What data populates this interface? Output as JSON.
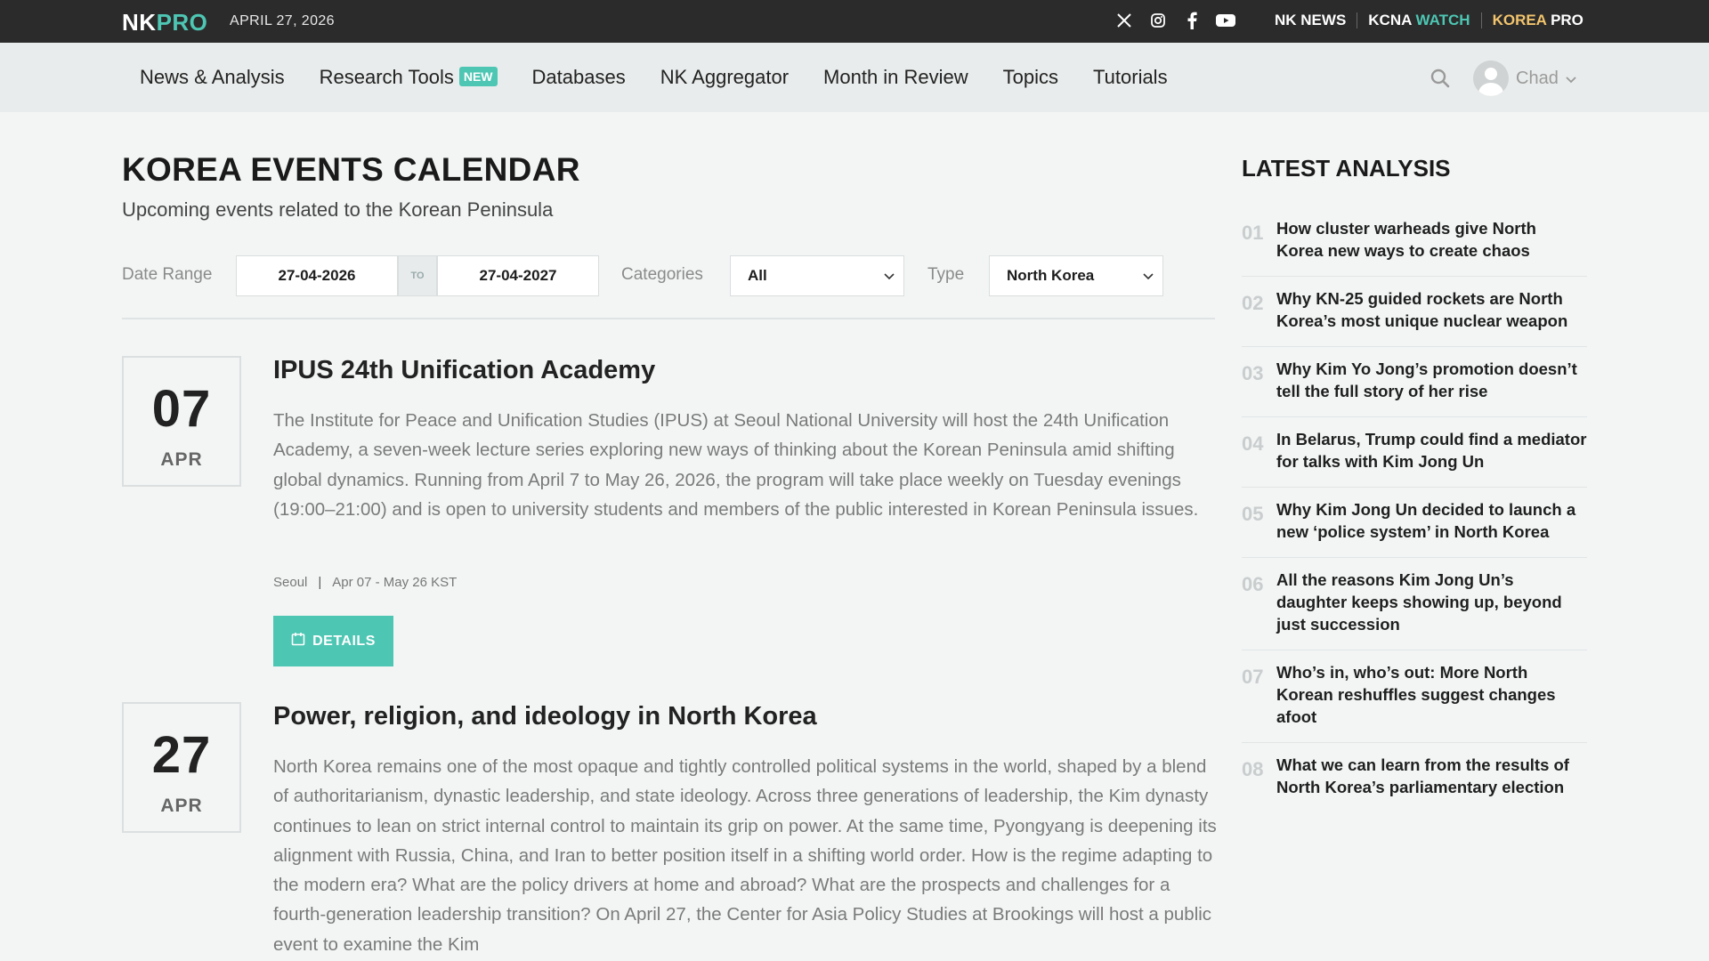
{
  "topbar": {
    "logo_nk": "NK",
    "logo_pro": "PRO",
    "date": "APRIL 27, 2026",
    "social_icons": [
      "x-icon",
      "instagram-icon",
      "facebook-icon",
      "youtube-icon"
    ],
    "sites": {
      "nknews": "NK NEWS",
      "kcna_1": "KCNA",
      "kcna_2": "WATCH",
      "kp_1": "KOREA",
      "kp_2": "PRO"
    }
  },
  "nav": {
    "items": [
      "News & Analysis",
      "Research Tools",
      "Databases",
      "NK Aggregator",
      "Month in Review",
      "Topics",
      "Tutorials"
    ],
    "new_badge": "NEW",
    "user_name": "Chad"
  },
  "page": {
    "title": "KOREA EVENTS CALENDAR",
    "subtitle": "Upcoming events related to the Korean Peninsula"
  },
  "filters": {
    "date_range_label": "Date Range",
    "date_from": "27-04-2026",
    "to_label": "TO",
    "date_to": "27-04-2027",
    "categories_label": "Categories",
    "categories_value": "All",
    "type_label": "Type",
    "type_value": "North Korea"
  },
  "events": [
    {
      "day": "07",
      "month": "APR",
      "title": "IPUS 24th Unification Academy",
      "description": "The Institute for Peace and Unification Studies (IPUS) at Seoul National University will host the 24th Unification Academy, a seven-week lecture series exploring new ways of thinking about the Korean Peninsula amid shifting global dynamics. Running from April 7 to May 26, 2026, the program will take place weekly on Tuesday evenings (19:00–21:00) and is open to university students and members of the public interested in Korean Peninsula issues.",
      "location": "Seoul",
      "when": "Apr 07 - May 26 KST",
      "button": "DETAILS"
    },
    {
      "day": "27",
      "month": "APR",
      "title": "Power, religion, and ideology in North Korea",
      "description": "North Korea remains one of the most opaque and tightly controlled political systems in the world, shaped by a blend of authoritarianism, dynastic leadership, and state ideology. Across three generations of leadership, the Kim dynasty continues to lean on strict internal control to maintain its grip on power. At the same time, Pyongyang is deepening its alignment with Russia, China, and Iran to better position itself in a shifting world order. How is the regime adapting to the modern era? What are the policy drivers at home and abroad? What are the prospects and challenges for a fourth-generation leadership transition? On April 27, the Center for Asia Policy Studies at Brookings will host a public event to examine the Kim"
    }
  ],
  "sidebar": {
    "title": "LATEST ANALYSIS",
    "items": [
      {
        "num": "01",
        "text": "How cluster warheads give North Korea new ways to create chaos"
      },
      {
        "num": "02",
        "text": "Why KN-25 guided rockets are North Korea’s most unique nuclear weapon"
      },
      {
        "num": "03",
        "text": "Why Kim Yo Jong’s promotion doesn’t tell the full story of her rise"
      },
      {
        "num": "04",
        "text": "In Belarus, Trump could find a mediator for talks with Kim Jong Un"
      },
      {
        "num": "05",
        "text": "Why Kim Jong Un decided to launch a new ‘police system’ in North Korea"
      },
      {
        "num": "06",
        "text": "All the reasons Kim Jong Un’s daughter keeps showing up, beyond just succession"
      },
      {
        "num": "07",
        "text": "Who’s in, who’s out: More North Korean reshuffles suggest changes afoot"
      },
      {
        "num": "08",
        "text": "What we can learn from the results of North Korea’s parliamentary election"
      }
    ]
  }
}
